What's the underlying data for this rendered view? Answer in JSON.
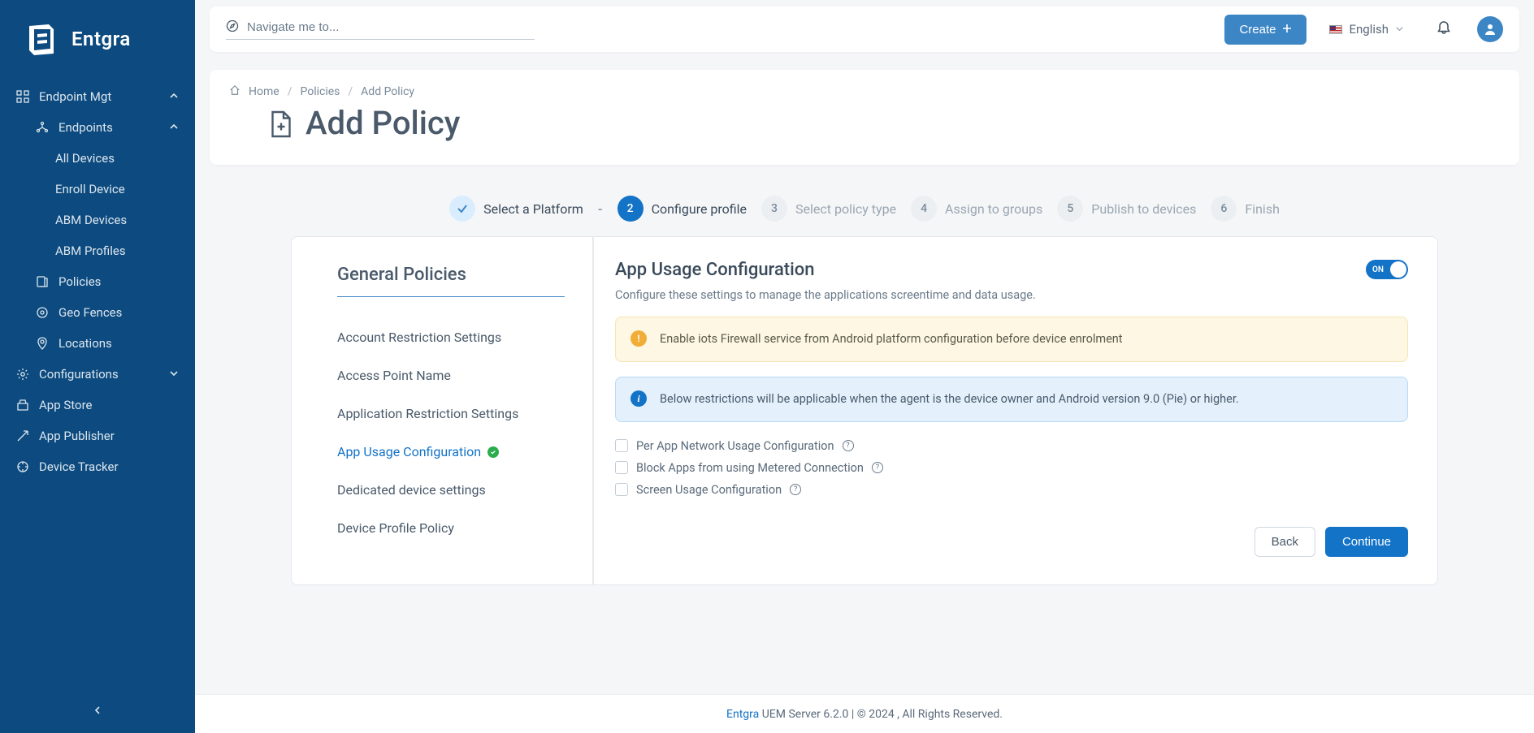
{
  "brand": "Entgra",
  "topbar": {
    "search_placeholder": "Navigate me to...",
    "create_label": "Create",
    "language": "English"
  },
  "sidebar": {
    "items": [
      {
        "label": "Endpoint Mgt",
        "expanded": true
      },
      {
        "label": "Endpoints",
        "expanded": true
      },
      {
        "label": "All Devices"
      },
      {
        "label": "Enroll Device"
      },
      {
        "label": "ABM Devices"
      },
      {
        "label": "ABM Profiles"
      },
      {
        "label": "Policies"
      },
      {
        "label": "Geo Fences"
      },
      {
        "label": "Locations"
      },
      {
        "label": "Configurations",
        "expanded": false
      },
      {
        "label": "App Store"
      },
      {
        "label": "App Publisher"
      },
      {
        "label": "Device Tracker"
      }
    ]
  },
  "breadcrumb": {
    "home": "Home",
    "policies": "Policies",
    "add": "Add Policy"
  },
  "page_title": "Add Policy",
  "steps": [
    {
      "label": "Select a Platform",
      "state": "done"
    },
    {
      "num": "2",
      "label": "Configure profile",
      "state": "active"
    },
    {
      "num": "3",
      "label": "Select policy type",
      "state": "pending"
    },
    {
      "num": "4",
      "label": "Assign to groups",
      "state": "pending"
    },
    {
      "num": "5",
      "label": "Publish to devices",
      "state": "pending"
    },
    {
      "num": "6",
      "label": "Finish",
      "state": "pending"
    }
  ],
  "left_panel": {
    "title": "General Policies",
    "items": [
      "Account Restriction Settings",
      "Access Point Name",
      "Application Restriction Settings",
      "App Usage Configuration",
      "Dedicated device settings",
      "Device Profile Policy"
    ],
    "active_index": 3
  },
  "right_panel": {
    "title": "App Usage Configuration",
    "toggle_label": "ON",
    "desc": "Configure these settings to manage the applications screentime and data usage.",
    "warn": "Enable iots Firewall service from Android platform configuration before device enrolment",
    "info": "Below restrictions will be applicable when the agent is the device owner and Android version 9.0 (Pie) or higher.",
    "checks": [
      "Per App Network Usage Configuration",
      "Block Apps from using Metered Connection",
      "Screen Usage Configuration"
    ],
    "back": "Back",
    "continue": "Continue"
  },
  "footer": {
    "brand": "Entgra",
    "text": " UEM Server 6.2.0 | © 2024 , All Rights Reserved."
  }
}
